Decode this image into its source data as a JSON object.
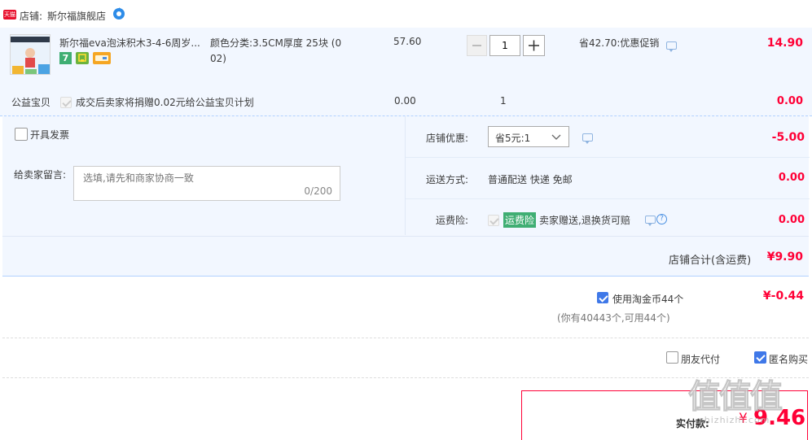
{
  "shop": {
    "tmall_badge": "天猫",
    "label": "店铺:",
    "name": "斯尔福旗舰店"
  },
  "item": {
    "title": "斯尔福eva泡沫积木3-4-6周岁...",
    "sku_line1": "颜色分类:3.5CM厚度 25块 (0",
    "sku_line2": "02)",
    "price": "57.60",
    "quantity": "1",
    "promo": "省42.70:优惠促销",
    "subtotal": "14.90",
    "badge_seven": "7"
  },
  "charity": {
    "label": "公益宝贝",
    "text": "成交后卖家将捐赠0.02元给公益宝贝计划",
    "price": "0.00",
    "qty": "1",
    "subtotal": "0.00"
  },
  "invoice": {
    "label": "开具发票"
  },
  "message": {
    "label": "给卖家留言:",
    "placeholder": "选填,请先和商家协商一致",
    "counter": "0/200"
  },
  "shop_discount": {
    "label": "店铺优惠:",
    "selected": "省5元:1",
    "amount": "-5.00"
  },
  "shipping": {
    "label": "运送方式:",
    "text": "普通配送 快递 免邮",
    "amount": "0.00"
  },
  "insurance": {
    "label": "运费险:",
    "tag": "运费险",
    "text": "卖家赠送,退换货可赔",
    "amount": "0.00"
  },
  "shop_total": {
    "label": "店铺合计(含运费)",
    "amount": "¥9.90"
  },
  "coins": {
    "label": "使用淘金币44个",
    "amount": "¥-0.44",
    "note": "(你有40443个,可用44个)"
  },
  "options": {
    "friend_pay": "朋友代付",
    "anonymous": "匿名购买"
  },
  "payment": {
    "label": "实付款:",
    "currency": "¥",
    "amount": "9.46"
  },
  "watermark": {
    "text": "值值值",
    "sub": "zhizhizhi.com"
  },
  "colors": {
    "accent_red": "#ff0036",
    "checkbox_blue": "#3f78e8",
    "panel_bg": "#f2f7ff",
    "dashed_border": "#b2d1ff",
    "insurance_green": "#3fae73"
  },
  "icons": [
    "tmall-badge-icon",
    "shop-contact-icon",
    "seven-day-return-icon",
    "shop-guarantee-icon",
    "credit-card-icon",
    "chat-bubble-icon",
    "help-icon",
    "chevron-down-icon",
    "minus-icon",
    "plus-icon"
  ]
}
